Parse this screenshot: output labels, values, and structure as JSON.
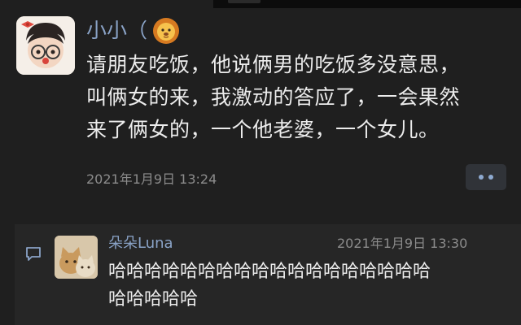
{
  "post": {
    "nickname": "小小（",
    "text_lines": [
      "请朋友吃饭，他说俩男的吃饭多没意思，",
      "叫俩女的来，我激动的答应了，一会果然",
      "来了俩女的，一个他老婆，一个女儿。"
    ],
    "time": "2021年1月9日 13:24"
  },
  "comment": {
    "name": "朵朵Luna",
    "time": "2021年1月9日 13:30",
    "text_lines": [
      "哈哈哈哈哈哈哈哈哈哈哈哈哈哈哈哈哈哈",
      "哈哈哈哈哈"
    ]
  },
  "icons": {
    "nickname_suffix": "lion-emoji",
    "more": "more-dots-icon",
    "comment": "comment-bubble-icon"
  },
  "colors": {
    "background": "#1f1f1f",
    "name_link": "#8aa3c7",
    "text": "#ececec",
    "timestamp": "#8c8c8c"
  }
}
